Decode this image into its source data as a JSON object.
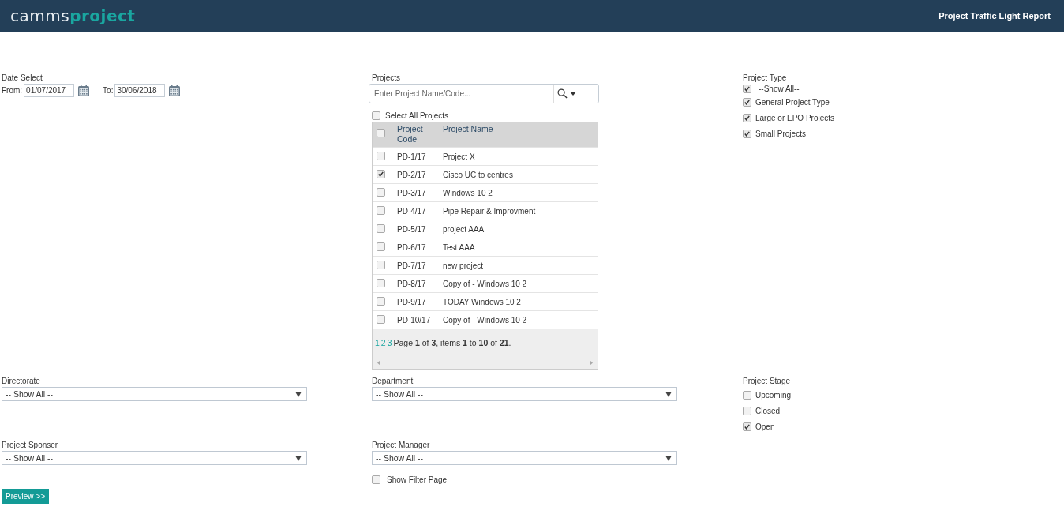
{
  "header": {
    "logo_left": "camms",
    "logo_right": "project",
    "title": "Project Traffic Light Report"
  },
  "date_select": {
    "label": "Date Select",
    "from_label": "From:",
    "from_value": "01/07/2017",
    "to_label": "To:",
    "to_value": "30/06/2018"
  },
  "projects": {
    "label": "Projects",
    "search_placeholder": "Enter Project Name/Code...",
    "select_all": {
      "label": "Select All Projects",
      "checked": false
    },
    "header_checked": false,
    "columns": [
      "Project Code",
      "Project Name"
    ],
    "rows": [
      {
        "code": "PD-1/17",
        "name": "Project X",
        "checked": false
      },
      {
        "code": "PD-2/17",
        "name": "Cisco UC to centres",
        "checked": true
      },
      {
        "code": "PD-3/17",
        "name": "Windows 10 2",
        "checked": false
      },
      {
        "code": "PD-4/17",
        "name": "Pipe Repair & Improvment",
        "checked": false
      },
      {
        "code": "PD-5/17",
        "name": "project AAA",
        "checked": false
      },
      {
        "code": "PD-6/17",
        "name": "Test AAA",
        "checked": false
      },
      {
        "code": "PD-7/17",
        "name": "new project",
        "checked": false
      },
      {
        "code": "PD-8/17",
        "name": "Copy of - Windows 10 2",
        "checked": false
      },
      {
        "code": "PD-9/17",
        "name": "TODAY Windows 10 2",
        "checked": false
      },
      {
        "code": "PD-10/17",
        "name": "Copy of - Windows 10 2",
        "checked": false
      }
    ],
    "pages": [
      "1",
      "2",
      "3"
    ],
    "pager_text": "Page **1** of **3**, items **1** to **10** of **21**."
  },
  "project_type": {
    "label": "Project Type",
    "options": [
      {
        "label": "--Show All--",
        "checked": true
      },
      {
        "label": "General Project Type",
        "checked": true
      },
      {
        "label": "Large or EPO Projects",
        "checked": true
      },
      {
        "label": "Small Projects",
        "checked": true
      }
    ]
  },
  "directorate": {
    "label": "Directorate",
    "value": "-- Show All --"
  },
  "department": {
    "label": "Department",
    "value": "-- Show All --"
  },
  "project_stage": {
    "label": "Project Stage",
    "options": [
      {
        "label": "Upcoming",
        "checked": false
      },
      {
        "label": "Closed",
        "checked": false
      },
      {
        "label": "Open",
        "checked": true
      }
    ]
  },
  "project_sponser": {
    "label": "Project Sponser",
    "value": "-- Show All --"
  },
  "project_manager": {
    "label": "Project Manager",
    "value": "-- Show All --"
  },
  "show_filter_page": {
    "label": "Show Filter Page",
    "checked": false
  },
  "preview_button": "Preview >>"
}
